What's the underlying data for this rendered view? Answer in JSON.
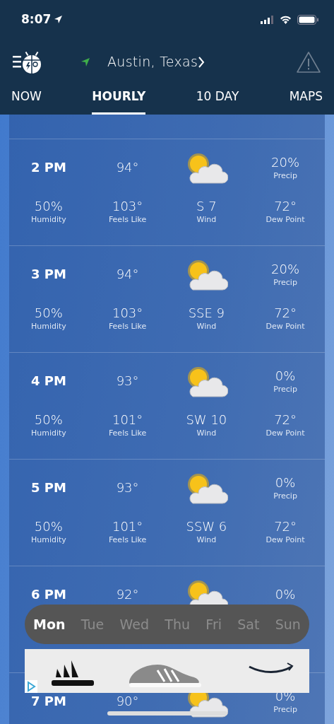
{
  "status_bar": {
    "time": "8:07"
  },
  "header": {
    "location": "Austin, Texas"
  },
  "tabs": [
    {
      "label": "NOW",
      "selected": false
    },
    {
      "label": "HOURLY",
      "selected": true
    },
    {
      "label": "10 DAY",
      "selected": false
    },
    {
      "label": "MAPS",
      "selected": false
    }
  ],
  "hours": [
    {
      "time": "2 PM",
      "temp": "94°",
      "precip": "20%",
      "precip_label": "Precip",
      "humidity": "50%",
      "humidity_label": "Humidity",
      "feels_like": "103°",
      "feels_like_label": "Feels Like",
      "wind": "S 7",
      "wind_label": "Wind",
      "dew_point": "72°",
      "dew_point_label": "Dew Point"
    },
    {
      "time": "3 PM",
      "temp": "94°",
      "precip": "20%",
      "precip_label": "Precip",
      "humidity": "50%",
      "humidity_label": "Humidity",
      "feels_like": "103°",
      "feels_like_label": "Feels Like",
      "wind": "SSE 9",
      "wind_label": "Wind",
      "dew_point": "72°",
      "dew_point_label": "Dew Point"
    },
    {
      "time": "4 PM",
      "temp": "93°",
      "precip": "0%",
      "precip_label": "Precip",
      "humidity": "50%",
      "humidity_label": "Humidity",
      "feels_like": "101°",
      "feels_like_label": "Feels Like",
      "wind": "SW 10",
      "wind_label": "Wind",
      "dew_point": "72°",
      "dew_point_label": "Dew Point"
    },
    {
      "time": "5 PM",
      "temp": "93°",
      "precip": "0%",
      "precip_label": "Precip",
      "humidity": "50%",
      "humidity_label": "Humidity",
      "feels_like": "101°",
      "feels_like_label": "Feels Like",
      "wind": "SSW 6",
      "wind_label": "Wind",
      "dew_point": "72°",
      "dew_point_label": "Dew Point"
    },
    {
      "time": "6 PM",
      "temp": "92°",
      "precip": "0%"
    },
    {
      "time": "7 PM",
      "temp": "90°",
      "precip": "0%",
      "precip_label": "Precip"
    }
  ],
  "days": [
    {
      "label": "Mon",
      "selected": true
    },
    {
      "label": "Tue",
      "selected": false
    },
    {
      "label": "Wed",
      "selected": false
    },
    {
      "label": "Thu",
      "selected": false
    },
    {
      "label": "Fri",
      "selected": false
    },
    {
      "label": "Sat",
      "selected": false
    },
    {
      "label": "Sun",
      "selected": false
    }
  ]
}
